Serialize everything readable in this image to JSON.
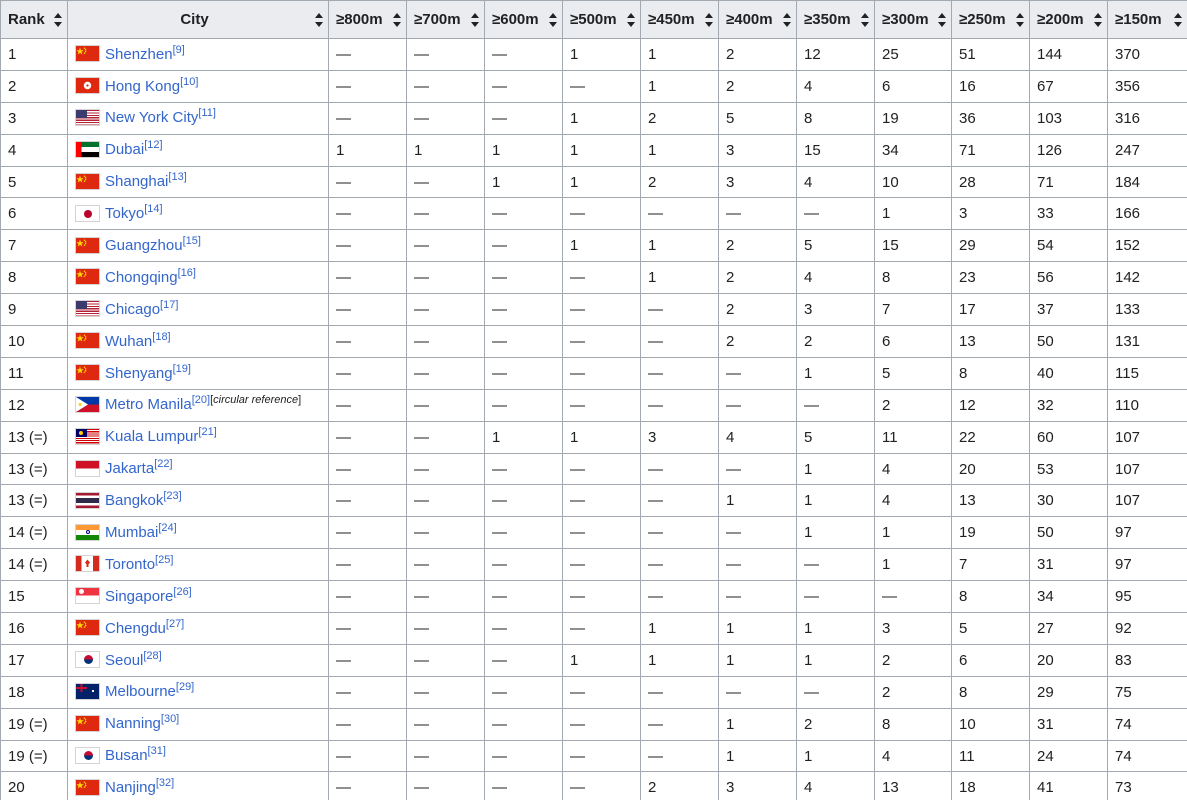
{
  "headers": [
    "Rank",
    "City",
    "≥800m",
    "≥700m",
    "≥600m",
    "≥500m",
    "≥450m",
    "≥400m",
    "≥350m",
    "≥300m",
    "≥250m",
    "≥200m",
    "≥150m"
  ],
  "flag_colors": {
    "china": "#de2910",
    "hongkong": "#de2910",
    "usa_red": "#b22234",
    "usa_blue": "#3c3b6e",
    "uae_green": "#00732f",
    "uae_red": "#ff0000",
    "japan_red": "#bc002d",
    "philippines_blue": "#0038a8",
    "philippines_red": "#ce1126",
    "malaysia_blue": "#010066",
    "malaysia_red": "#cc0001",
    "indonesia_red": "#ce1126",
    "thailand_red": "#a51931",
    "thailand_blue": "#2d2a4a",
    "india_saffron": "#ff9933",
    "india_green": "#138808",
    "canada_red": "#d52b1e",
    "singapore_red": "#ef3340",
    "korea_red": "#c60c30",
    "korea_blue": "#003478",
    "australia_blue": "#012169"
  },
  "rows": [
    {
      "rank": "1",
      "city": "Shenzhen",
      "ref": "[9]",
      "note": "",
      "flag": "china-flag",
      "values": [
        "—",
        "—",
        "—",
        "1",
        "1",
        "2",
        "12",
        "25",
        "51",
        "144",
        "370"
      ]
    },
    {
      "rank": "2",
      "city": "Hong Kong",
      "ref": "[10]",
      "note": "",
      "flag": "hongkong-flag",
      "values": [
        "—",
        "—",
        "—",
        "—",
        "1",
        "2",
        "4",
        "6",
        "16",
        "67",
        "356"
      ]
    },
    {
      "rank": "3",
      "city": "New York City",
      "ref": "[11]",
      "note": "",
      "flag": "usa-flag",
      "values": [
        "—",
        "—",
        "—",
        "1",
        "2",
        "5",
        "8",
        "19",
        "36",
        "103",
        "316"
      ]
    },
    {
      "rank": "4",
      "city": "Dubai",
      "ref": "[12]",
      "note": "",
      "flag": "uae-flag",
      "values": [
        "1",
        "1",
        "1",
        "1",
        "1",
        "3",
        "15",
        "34",
        "71",
        "126",
        "247"
      ]
    },
    {
      "rank": "5",
      "city": "Shanghai",
      "ref": "[13]",
      "note": "",
      "flag": "china-flag",
      "values": [
        "—",
        "—",
        "1",
        "1",
        "2",
        "3",
        "4",
        "10",
        "28",
        "71",
        "184"
      ]
    },
    {
      "rank": "6",
      "city": "Tokyo",
      "ref": "[14]",
      "note": "",
      "flag": "japan-flag",
      "values": [
        "—",
        "—",
        "—",
        "—",
        "—",
        "—",
        "—",
        "1",
        "3",
        "33",
        "166"
      ]
    },
    {
      "rank": "7",
      "city": "Guangzhou",
      "ref": "[15]",
      "note": "",
      "flag": "china-flag",
      "values": [
        "—",
        "—",
        "—",
        "1",
        "1",
        "2",
        "5",
        "15",
        "29",
        "54",
        "152"
      ]
    },
    {
      "rank": "8",
      "city": "Chongqing",
      "ref": "[16]",
      "note": "",
      "flag": "china-flag",
      "values": [
        "—",
        "—",
        "—",
        "—",
        "1",
        "2",
        "4",
        "8",
        "23",
        "56",
        "142"
      ]
    },
    {
      "rank": "9",
      "city": "Chicago",
      "ref": "[17]",
      "note": "",
      "flag": "usa-flag",
      "values": [
        "—",
        "—",
        "—",
        "—",
        "—",
        "2",
        "3",
        "7",
        "17",
        "37",
        "133"
      ]
    },
    {
      "rank": "10",
      "city": "Wuhan",
      "ref": "[18]",
      "note": "",
      "flag": "china-flag",
      "values": [
        "—",
        "—",
        "—",
        "—",
        "—",
        "2",
        "2",
        "6",
        "13",
        "50",
        "131"
      ]
    },
    {
      "rank": "11",
      "city": "Shenyang",
      "ref": "[19]",
      "note": "",
      "flag": "china-flag",
      "values": [
        "—",
        "—",
        "—",
        "—",
        "—",
        "—",
        "1",
        "5",
        "8",
        "40",
        "115"
      ]
    },
    {
      "rank": "12",
      "city": "Metro Manila",
      "ref": "[20]",
      "note": "circular reference",
      "flag": "philippines-flag",
      "values": [
        "—",
        "—",
        "—",
        "—",
        "—",
        "—",
        "—",
        "2",
        "12",
        "32",
        "110"
      ]
    },
    {
      "rank": "13 (=)",
      "city": "Kuala Lumpur",
      "ref": "[21]",
      "note": "",
      "flag": "malaysia-flag",
      "values": [
        "—",
        "—",
        "1",
        "1",
        "3",
        "4",
        "5",
        "11",
        "22",
        "60",
        "107"
      ]
    },
    {
      "rank": "13 (=)",
      "city": "Jakarta",
      "ref": "[22]",
      "note": "",
      "flag": "indonesia-flag",
      "values": [
        "—",
        "—",
        "—",
        "—",
        "—",
        "—",
        "1",
        "4",
        "20",
        "53",
        "107"
      ]
    },
    {
      "rank": "13 (=)",
      "city": "Bangkok",
      "ref": "[23]",
      "note": "",
      "flag": "thailand-flag",
      "values": [
        "—",
        "—",
        "—",
        "—",
        "—",
        "1",
        "1",
        "4",
        "13",
        "30",
        "107"
      ]
    },
    {
      "rank": "14 (=)",
      "city": "Mumbai",
      "ref": "[24]",
      "note": "",
      "flag": "india-flag",
      "values": [
        "—",
        "—",
        "—",
        "—",
        "—",
        "—",
        "1",
        "1",
        "19",
        "50",
        "97"
      ]
    },
    {
      "rank": "14 (=)",
      "city": "Toronto",
      "ref": "[25]",
      "note": "",
      "flag": "canada-flag",
      "values": [
        "—",
        "—",
        "—",
        "—",
        "—",
        "—",
        "—",
        "1",
        "7",
        "31",
        "97"
      ]
    },
    {
      "rank": "15",
      "city": "Singapore",
      "ref": "[26]",
      "note": "",
      "flag": "singapore-flag",
      "values": [
        "—",
        "—",
        "—",
        "—",
        "—",
        "—",
        "—",
        "—",
        "8",
        "34",
        "95"
      ]
    },
    {
      "rank": "16",
      "city": "Chengdu",
      "ref": "[27]",
      "note": "",
      "flag": "china-flag",
      "values": [
        "—",
        "—",
        "—",
        "—",
        "1",
        "1",
        "1",
        "3",
        "5",
        "27",
        "92"
      ]
    },
    {
      "rank": "17",
      "city": "Seoul",
      "ref": "[28]",
      "note": "",
      "flag": "korea-flag",
      "values": [
        "—",
        "—",
        "—",
        "1",
        "1",
        "1",
        "1",
        "2",
        "6",
        "20",
        "83"
      ]
    },
    {
      "rank": "18",
      "city": "Melbourne",
      "ref": "[29]",
      "note": "",
      "flag": "australia-flag",
      "values": [
        "—",
        "—",
        "—",
        "—",
        "—",
        "—",
        "—",
        "2",
        "8",
        "29",
        "75"
      ]
    },
    {
      "rank": "19 (=)",
      "city": "Nanning",
      "ref": "[30]",
      "note": "",
      "flag": "china-flag",
      "values": [
        "—",
        "—",
        "—",
        "—",
        "—",
        "1",
        "2",
        "8",
        "10",
        "31",
        "74"
      ]
    },
    {
      "rank": "19 (=)",
      "city": "Busan",
      "ref": "[31]",
      "note": "",
      "flag": "korea-flag",
      "values": [
        "—",
        "—",
        "—",
        "—",
        "—",
        "1",
        "1",
        "4",
        "11",
        "24",
        "74"
      ]
    },
    {
      "rank": "20",
      "city": "Nanjing",
      "ref": "[32]",
      "note": "",
      "flag": "china-flag",
      "values": [
        "—",
        "—",
        "—",
        "—",
        "2",
        "3",
        "4",
        "13",
        "18",
        "41",
        "73"
      ]
    }
  ]
}
